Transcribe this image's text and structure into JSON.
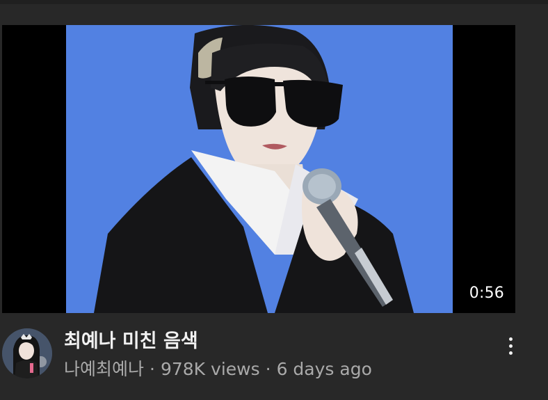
{
  "video": {
    "duration": "0:56",
    "title": "최예나 미친 음색",
    "channel": "나예최예나",
    "views": "978K views",
    "age": "6 days ago",
    "separator": "·"
  },
  "icons": {
    "menu": "more-vert-icon"
  },
  "colors": {
    "background": "#282828",
    "title_text": "#f1f1f1",
    "meta_text": "#aaaaaa",
    "thumbnail_backdrop": "#4f7fe0"
  }
}
